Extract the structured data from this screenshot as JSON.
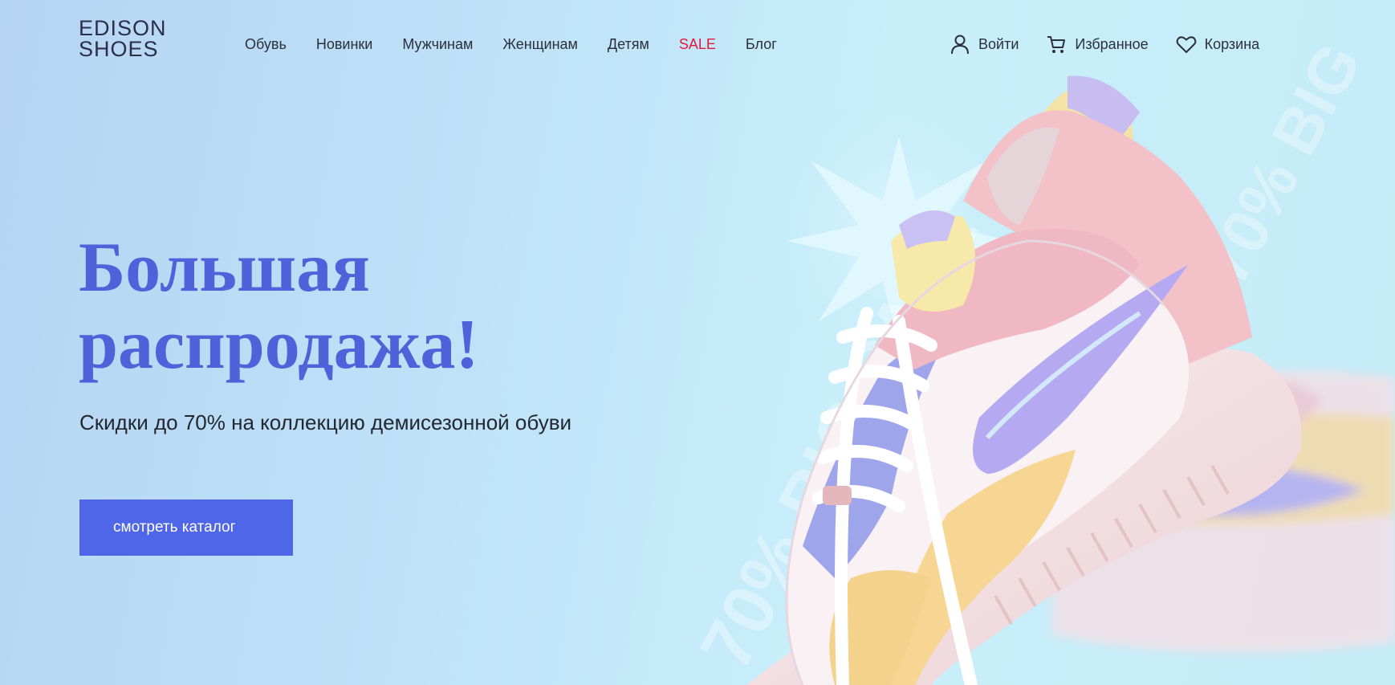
{
  "brand": {
    "logo_line1": "EDISON",
    "logo_line2": "SHOES"
  },
  "nav": {
    "items": [
      {
        "label": "Обувь"
      },
      {
        "label": "Новинки"
      },
      {
        "label": "Мужчинам"
      },
      {
        "label": "Женщинам"
      },
      {
        "label": "Детям"
      },
      {
        "label": "SALE"
      },
      {
        "label": "Блог"
      }
    ]
  },
  "user_links": {
    "login": "Войти",
    "favorites": "Избранное",
    "cart": "Корзина"
  },
  "hero": {
    "title_line1": "Большая",
    "title_line2": "распродажа!",
    "subtitle": "Скидки до 70% на коллекцию демисезонной обуви",
    "cta": "смотреть каталог",
    "watermark": "70% BIG SALE"
  },
  "colors": {
    "accent": "#4f62d9",
    "button": "#4f66e8",
    "sale": "#e5173b"
  },
  "icons": {
    "login": "user-icon",
    "favorites": "cart-icon",
    "cart": "heart-icon"
  }
}
